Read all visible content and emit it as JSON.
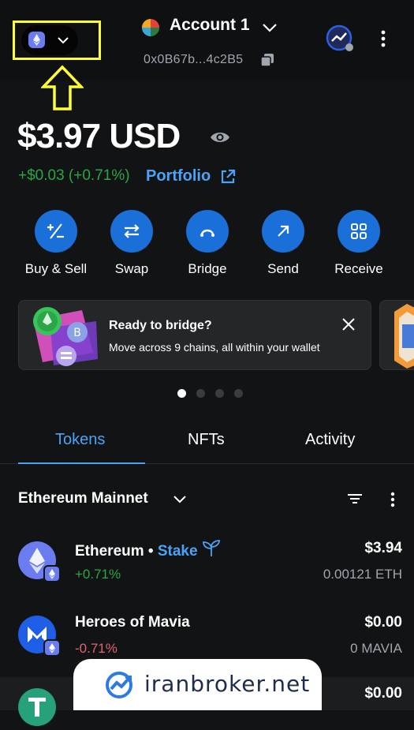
{
  "header": {
    "account_name": "Account 1",
    "account_address": "0x0B67b...4c2B5"
  },
  "balance": {
    "amount": "$3.97",
    "currency": "USD",
    "change": "+$0.03 (+0.71%)",
    "portfolio_label": "Portfolio"
  },
  "actions": [
    {
      "label": "Buy & Sell",
      "icon": "plus-minus-icon"
    },
    {
      "label": "Swap",
      "icon": "swap-arrows-icon"
    },
    {
      "label": "Bridge",
      "icon": "bridge-icon"
    },
    {
      "label": "Send",
      "icon": "arrow-up-right-icon"
    },
    {
      "label": "Receive",
      "icon": "qr-code-icon"
    }
  ],
  "banner": {
    "title": "Ready to bridge?",
    "subtitle": "Move across 9 chains, all within your wallet"
  },
  "tabs": [
    "Tokens",
    "NFTs",
    "Activity"
  ],
  "network_filter": "Ethereum Mainnet",
  "tokens": [
    {
      "name": "Ethereum",
      "stake_label": "Stake",
      "change": "+0.71%",
      "fiat": "$3.94",
      "amount": "0.00121 ETH"
    },
    {
      "name": "Heroes of Mavia",
      "change": "-0.71%",
      "fiat": "$0.00",
      "amount": "0 MAVIA"
    },
    {
      "fiat": "$0.00"
    }
  ],
  "watermark": "iranbroker.net",
  "colors": {
    "accent": "#4ba3f7",
    "action_button": "#1a6fd9",
    "positive": "#28a745",
    "negative": "#e06470",
    "highlight": "#ffff33"
  }
}
